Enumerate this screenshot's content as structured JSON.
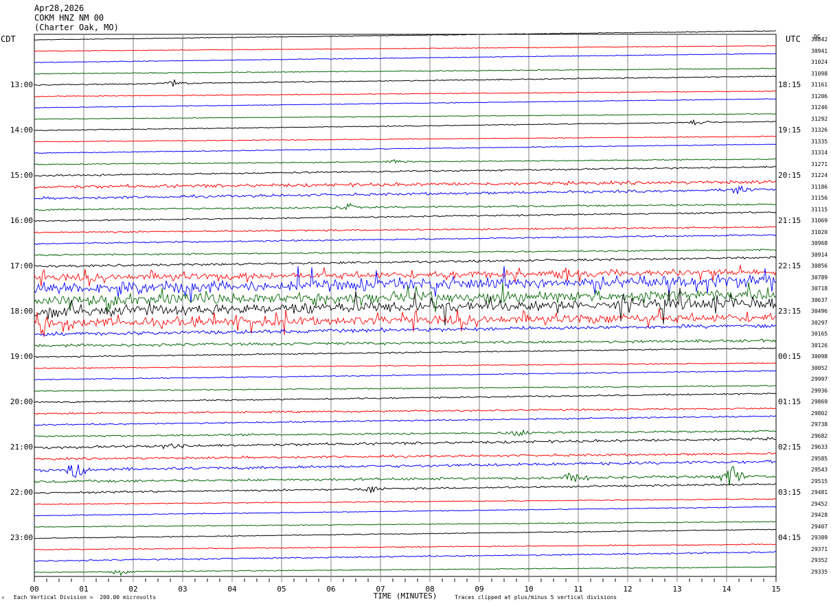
{
  "header": {
    "date": "Apr28,2026",
    "station": "COKM HNZ NM 00",
    "location": "(Charter Oak, MO)",
    "left_zone": "CDT",
    "right_zone": "UTC",
    "dc_label": "DC"
  },
  "footer": {
    "scale_note": "Each Vertical Division =  200.00 microvolts",
    "clip_note": "Traces clipped at plus/minus 5 vertical divisions",
    "corner_mark": "ᴹ"
  },
  "colors": {
    "trace_cycle": [
      "#000000",
      "#ff0000",
      "#0000ff",
      "#006400"
    ],
    "grid": "#808080",
    "background": "#ffffff"
  },
  "chart_data": {
    "type": "line",
    "title": "",
    "xlabel": "TIME (MINUTES)",
    "ylabel": "",
    "xlim": [
      0,
      15
    ],
    "x_tick_labels": [
      "00",
      "01",
      "02",
      "03",
      "04",
      "05",
      "06",
      "07",
      "08",
      "09",
      "10",
      "11",
      "12",
      "13",
      "14",
      "15"
    ],
    "grid": true,
    "traces_count": 48,
    "minutes_per_trace": 15,
    "left_hour_labels": [
      {
        "trace": 4,
        "label": "13:00"
      },
      {
        "trace": 8,
        "label": "14:00"
      },
      {
        "trace": 12,
        "label": "15:00"
      },
      {
        "trace": 16,
        "label": "16:00"
      },
      {
        "trace": 20,
        "label": "17:00"
      },
      {
        "trace": 24,
        "label": "18:00"
      },
      {
        "trace": 28,
        "label": "19:00"
      },
      {
        "trace": 32,
        "label": "20:00"
      },
      {
        "trace": 36,
        "label": "21:00"
      },
      {
        "trace": 40,
        "label": "22:00"
      },
      {
        "trace": 44,
        "label": "23:00"
      }
    ],
    "right_hour_labels": [
      {
        "trace": 4,
        "label": "18:15"
      },
      {
        "trace": 8,
        "label": "19:15"
      },
      {
        "trace": 12,
        "label": "20:15"
      },
      {
        "trace": 16,
        "label": "21:15"
      },
      {
        "trace": 20,
        "label": "22:15"
      },
      {
        "trace": 24,
        "label": "23:15"
      },
      {
        "trace": 28,
        "label": "00:15"
      },
      {
        "trace": 32,
        "label": "01:15"
      },
      {
        "trace": 36,
        "label": "02:15"
      },
      {
        "trace": 40,
        "label": "03:15"
      },
      {
        "trace": 44,
        "label": "04:15"
      }
    ],
    "dc_offsets": [
      "30842",
      "30941",
      "31024",
      "31098",
      "31161",
      "31206",
      "31246",
      "31292",
      "31326",
      "31335",
      "31314",
      "31271",
      "31224",
      "31186",
      "31156",
      "31115",
      "31069",
      "31020",
      "30968",
      "30914",
      "30856",
      "30789",
      "30718",
      "30637",
      "30496",
      "30297",
      "30165",
      "30126",
      "30098",
      "30052",
      "29997",
      "29936",
      "29869",
      "29802",
      "29738",
      "29682",
      "29633",
      "29585",
      "29543",
      "29515",
      "29481",
      "29452",
      "29428",
      "29407",
      "29389",
      "29371",
      "29352",
      "29335"
    ],
    "trace_noise_levels": [
      0.4,
      0.4,
      0.4,
      0.5,
      0.6,
      0.5,
      0.4,
      0.4,
      0.5,
      0.5,
      0.5,
      0.6,
      0.9,
      1.8,
      1.4,
      1.0,
      0.8,
      0.9,
      0.8,
      0.8,
      1.2,
      3.5,
      6.0,
      6.0,
      5.5,
      4.5,
      2.0,
      1.5,
      0.7,
      0.6,
      0.6,
      0.6,
      0.8,
      1.0,
      0.8,
      1.0,
      1.4,
      1.2,
      1.6,
      1.4,
      1.0,
      0.6,
      0.5,
      0.5,
      0.5,
      0.6,
      0.8,
      0.5
    ],
    "events": [
      {
        "trace": 4,
        "minute": 2.8,
        "amplitude": 5
      },
      {
        "trace": 8,
        "minute": 13.4,
        "amplitude": 7
      },
      {
        "trace": 11,
        "minute": 7.3,
        "amplitude": 5
      },
      {
        "trace": 14,
        "minute": 14.2,
        "amplitude": 8
      },
      {
        "trace": 15,
        "minute": 6.3,
        "amplitude": 8
      },
      {
        "trace": 21,
        "minute": 10.8,
        "amplitude": 14
      },
      {
        "trace": 25,
        "minute": 11.6,
        "amplitude": 12
      },
      {
        "trace": 35,
        "minute": 9.8,
        "amplitude": 8
      },
      {
        "trace": 36,
        "minute": 2.8,
        "amplitude": 7
      },
      {
        "trace": 38,
        "minute": 0.9,
        "amplitude": 16
      },
      {
        "trace": 39,
        "minute": 10.9,
        "amplitude": 15
      },
      {
        "trace": 39,
        "minute": 14.1,
        "amplitude": 18
      },
      {
        "trace": 40,
        "minute": 6.8,
        "amplitude": 7
      },
      {
        "trace": 47,
        "minute": 1.7,
        "amplitude": 6
      }
    ]
  }
}
